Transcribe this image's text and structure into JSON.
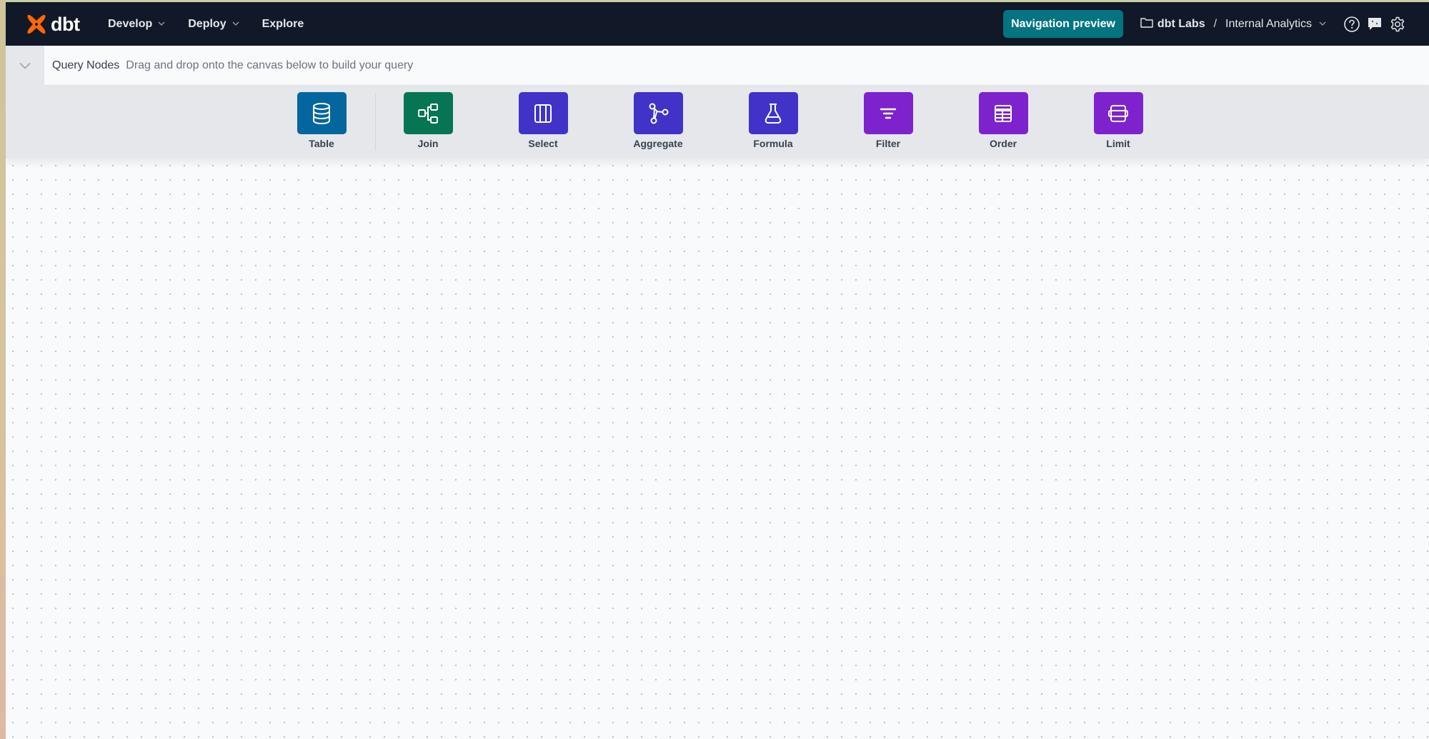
{
  "navbar": {
    "logo_text": "dbt",
    "menu": [
      {
        "label": "Develop",
        "has_dropdown": true
      },
      {
        "label": "Deploy",
        "has_dropdown": true
      },
      {
        "label": "Explore",
        "has_dropdown": false
      }
    ],
    "navigation_preview_label": "Navigation preview",
    "account": {
      "org": "dbt Labs",
      "separator": "/",
      "project": "Internal Analytics"
    },
    "icons": [
      "help-icon",
      "feedback-icon",
      "settings-icon"
    ]
  },
  "query_nodes": {
    "title": "Query Nodes",
    "subtitle": "Drag and drop onto the canvas below to build your query",
    "nodes": [
      {
        "label": "Table",
        "icon": "database-icon",
        "color": "#03669e"
      },
      {
        "label": "Join",
        "icon": "join-icon",
        "color": "#057553"
      },
      {
        "label": "Select",
        "icon": "columns-icon",
        "color": "#4133c8"
      },
      {
        "label": "Aggregate",
        "icon": "aggregate-icon",
        "color": "#4133c8"
      },
      {
        "label": "Formula",
        "icon": "flask-icon",
        "color": "#4133c8"
      },
      {
        "label": "Filter",
        "icon": "filter-icon",
        "color": "#7e22ce"
      },
      {
        "label": "Order",
        "icon": "table-grid-icon",
        "color": "#7e22ce"
      },
      {
        "label": "Limit",
        "icon": "limit-icon",
        "color": "#7e22ce"
      }
    ]
  },
  "colors": {
    "navbar_bg": "#111827",
    "brand_orange": "#fe6703",
    "preview_button": "#047481"
  }
}
